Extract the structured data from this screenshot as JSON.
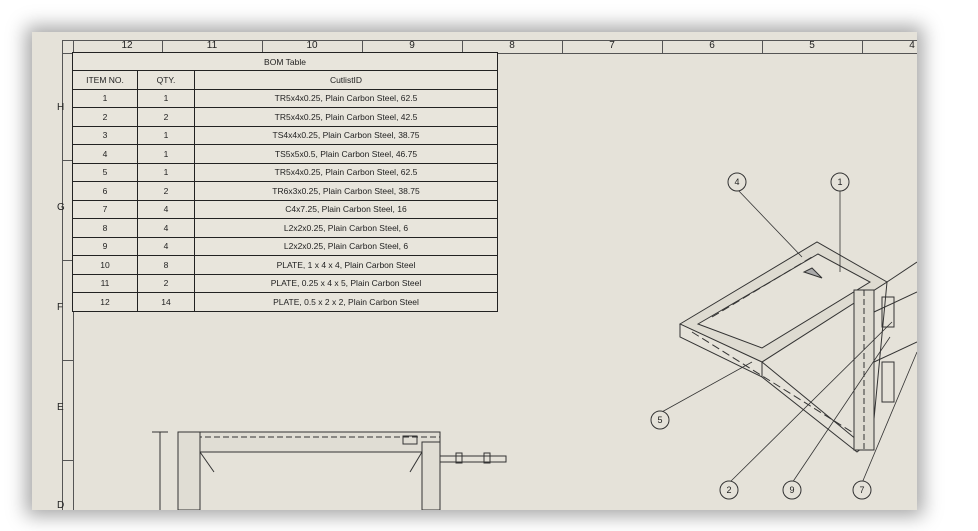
{
  "ruler": {
    "columns": [
      "12",
      "11",
      "10",
      "9",
      "8",
      "7",
      "6",
      "5",
      "4"
    ],
    "rows": [
      "H",
      "G",
      "F",
      "E",
      "D"
    ]
  },
  "bom": {
    "title": "BOM Table",
    "headers": [
      "ITEM NO.",
      "QTY.",
      "CutlistID"
    ],
    "rows": [
      [
        "1",
        "1",
        "TR5x4x0.25, Plain Carbon Steel, 62.5"
      ],
      [
        "2",
        "2",
        "TR5x4x0.25, Plain Carbon Steel, 42.5"
      ],
      [
        "3",
        "1",
        "TS4x4x0.25, Plain Carbon Steel, 38.75"
      ],
      [
        "4",
        "1",
        "TS5x5x0.5, Plain Carbon Steel, 46.75"
      ],
      [
        "5",
        "1",
        "TR5x4x0.25, Plain Carbon Steel, 62.5"
      ],
      [
        "6",
        "2",
        "TR6x3x0.25, Plain Carbon Steel, 38.75"
      ],
      [
        "7",
        "4",
        "C4x7.25, Plain Carbon Steel, 16"
      ],
      [
        "8",
        "4",
        "L2x2x0.25, Plain Carbon Steel, 6"
      ],
      [
        "9",
        "4",
        "L2x2x0.25, Plain Carbon Steel, 6"
      ],
      [
        "10",
        "8",
        "PLATE, 1 x 4 x 4, Plain Carbon Steel"
      ],
      [
        "11",
        "2",
        "PLATE, 0.25 x 4 x 5, Plain Carbon Steel"
      ],
      [
        "12",
        "14",
        "PLATE, 0.5 x 2 x 2, Plain Carbon Steel"
      ]
    ]
  },
  "balloons": [
    "4",
    "1",
    "5",
    "2",
    "9",
    "7"
  ]
}
